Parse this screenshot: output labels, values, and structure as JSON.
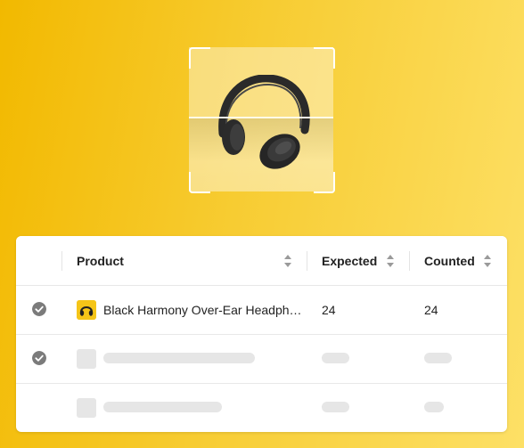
{
  "table": {
    "columns": [
      {
        "label": "Product",
        "sortable": true
      },
      {
        "label": "Expected",
        "sortable": true
      },
      {
        "label": "Counted",
        "sortable": true
      }
    ],
    "rows": [
      {
        "checked": true,
        "product": "Black Harmony Over-Ear Headph…",
        "expected": "24",
        "counted": "24",
        "loading": false
      },
      {
        "checked": true,
        "loading": true
      },
      {
        "checked": false,
        "loading": true
      }
    ]
  },
  "colors": {
    "accent": "#f5c518",
    "background_start": "#f2b900",
    "background_end": "#fde066",
    "check": "#7b7b7b",
    "skeleton": "#e6e6e6"
  },
  "icons": {
    "scanned_item": "headphones-icon",
    "scan_frame": "scan-frame-icon",
    "check": "check-circle-icon",
    "sort": "sort-arrows-icon"
  }
}
